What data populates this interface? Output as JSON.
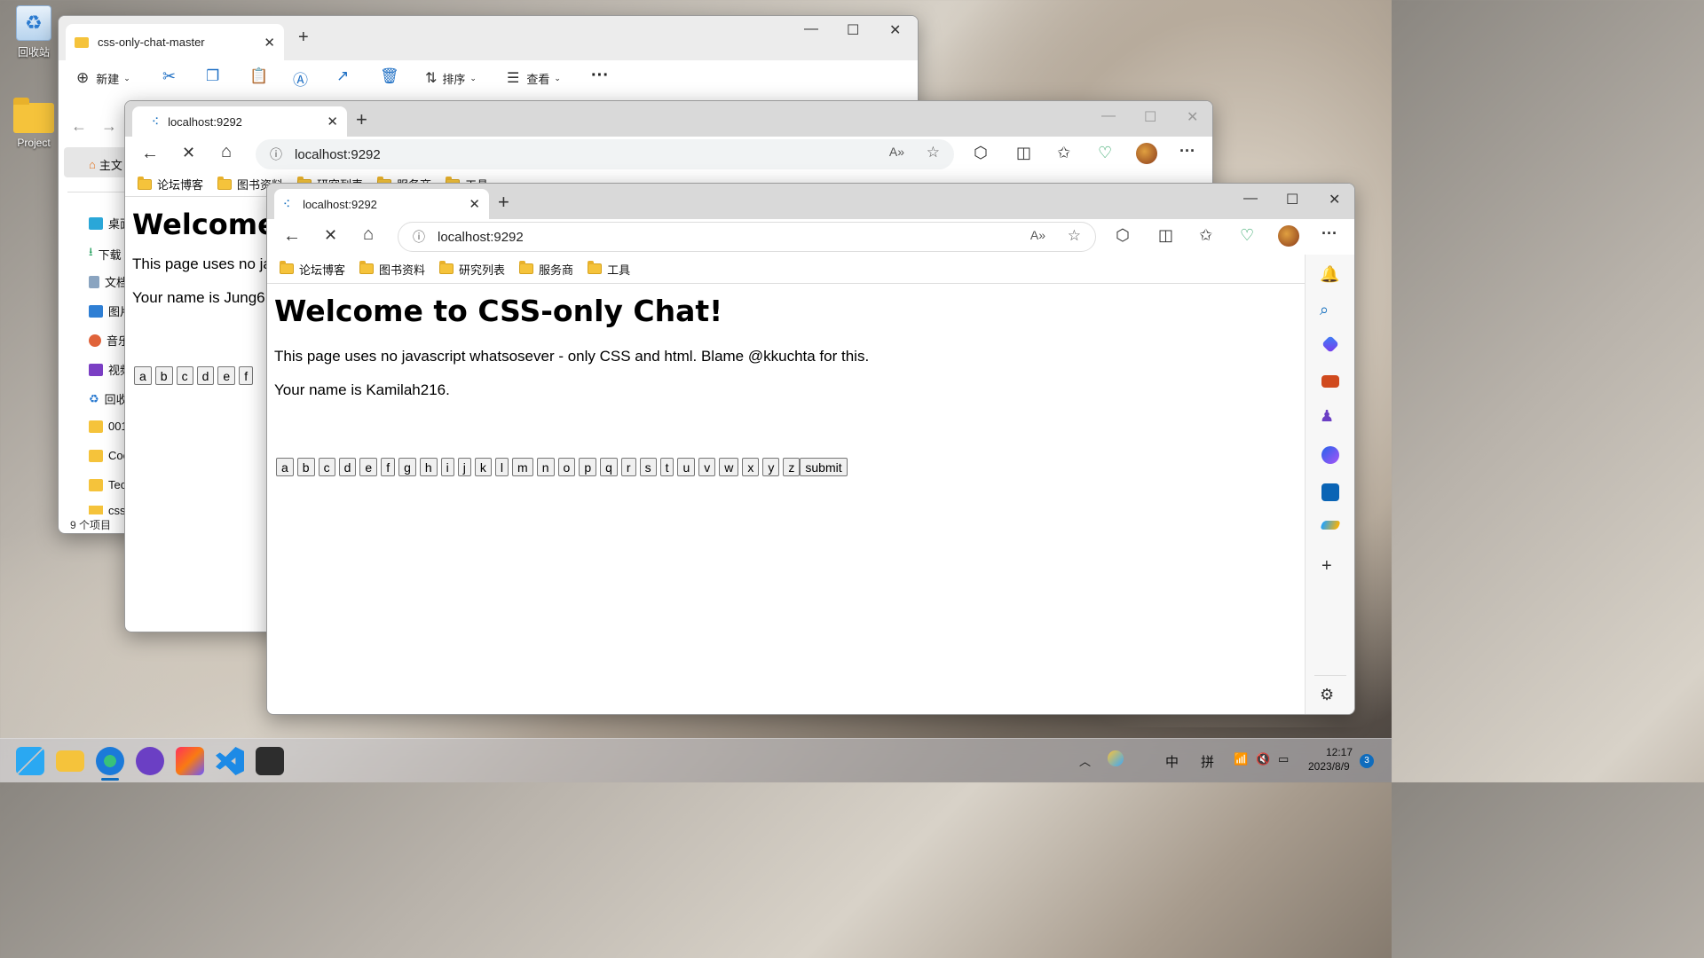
{
  "desktop": {
    "recycle_bin_label": "回收站",
    "project_label": "Project"
  },
  "explorer": {
    "tab_title": "css-only-chat-master",
    "toolbar": {
      "new_label": "新建",
      "sort_label": "排序",
      "view_label": "查看",
      "more_label": "···"
    },
    "sidebar": [
      {
        "label": "主文"
      },
      {
        "label": "桌面"
      },
      {
        "label": "下载"
      },
      {
        "label": "文档"
      },
      {
        "label": "图片"
      },
      {
        "label": "音乐"
      },
      {
        "label": "视频"
      },
      {
        "label": "回收"
      },
      {
        "label": "001"
      },
      {
        "label": "Coc"
      },
      {
        "label": "Tec"
      },
      {
        "label": "css"
      }
    ],
    "status": "9 个项目"
  },
  "browser_back": {
    "tab_title": "localhost:9292",
    "url": "localhost:9292",
    "favorites": [
      "论坛博客",
      "图书资料",
      "研究列表",
      "服务商",
      "工具"
    ],
    "page": {
      "heading": "Welcome",
      "line1": "This page uses no ja",
      "line2": "Your name is Jung6",
      "letters": [
        "a",
        "b",
        "c",
        "d",
        "e",
        "f"
      ]
    }
  },
  "browser_front": {
    "tab_title": "localhost:9292",
    "url": "localhost:9292",
    "favorites": [
      "论坛博客",
      "图书资料",
      "研究列表",
      "服务商",
      "工具"
    ],
    "page": {
      "heading": "Welcome to CSS-only Chat!",
      "line1": "This page uses no javascript whatsosever - only CSS and html. Blame @kkuchta for this.",
      "line2": "Your name is Kamilah216.",
      "letters": [
        "a",
        "b",
        "c",
        "d",
        "e",
        "f",
        "g",
        "h",
        "i",
        "j",
        "k",
        "l",
        "m",
        "n",
        "o",
        "p",
        "q",
        "r",
        "s",
        "t",
        "u",
        "v",
        "w",
        "x",
        "y",
        "z"
      ],
      "submit_label": "submit"
    }
  },
  "taskbar": {
    "ime_zh": "中",
    "ime_pin": "拼",
    "time": "12:17",
    "date": "2023/8/9",
    "notif_count": "3"
  },
  "colors": {
    "accent": "#0f6cbd",
    "folder": "#f5c33b"
  }
}
